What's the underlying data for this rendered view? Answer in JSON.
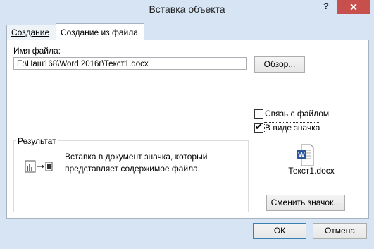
{
  "window": {
    "title": "Вставка объекта",
    "help": "?",
    "close": "✕"
  },
  "tabs": [
    {
      "label": "Создание"
    },
    {
      "label": "Создание из файла"
    }
  ],
  "file": {
    "label": "Имя файла:",
    "value": "E:\\Наш168\\Word 2016г\\Текст1.docx",
    "browse": "Обзор..."
  },
  "options": {
    "link": {
      "label": "Связь с файлом",
      "checked": false
    },
    "as_icon": {
      "label": "В виде значка",
      "checked": true
    }
  },
  "result": {
    "title": "Результат",
    "text": "Вставка в документ значка, который представляет содержимое файла."
  },
  "icon_preview": {
    "caption": "Текст1.docx",
    "change": "Сменить значок..."
  },
  "buttons": {
    "ok": "ОК",
    "cancel": "Отмена"
  }
}
